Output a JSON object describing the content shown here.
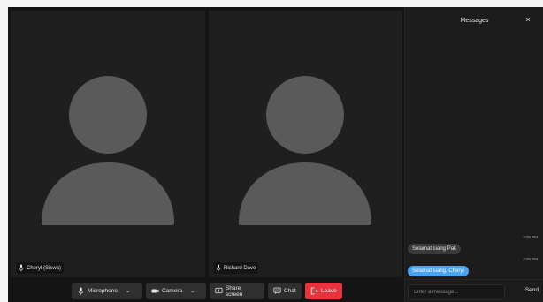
{
  "participants": [
    {
      "name": "Cheryl (Siswa)",
      "icon": "mic-icon"
    },
    {
      "name": "Richard Dave",
      "icon": "mic-icon"
    }
  ],
  "controls": {
    "microphone_label": "Microphone",
    "camera_label": "Camera",
    "share_label": "Share screen",
    "chat_label": "Chat",
    "leave_label": "Leave"
  },
  "messages_panel": {
    "title": "Messages",
    "close_symbol": "×",
    "messages": [
      {
        "time": "3:05 PM",
        "text": "Selamat siang Pak",
        "direction": "incoming"
      },
      {
        "time": "3:05 PM",
        "text": "Selamat siang, Cheryl",
        "direction": "outgoing"
      }
    ],
    "input_placeholder": "Enter a message...",
    "send_label": "Send"
  },
  "colors": {
    "background": "#141414",
    "tile": "#1f1f1f",
    "avatar": "#5a5a5a",
    "leave": "#e5343d",
    "outgoing_bubble": "#4aa3f0",
    "incoming_bubble": "#3a3a3a"
  }
}
